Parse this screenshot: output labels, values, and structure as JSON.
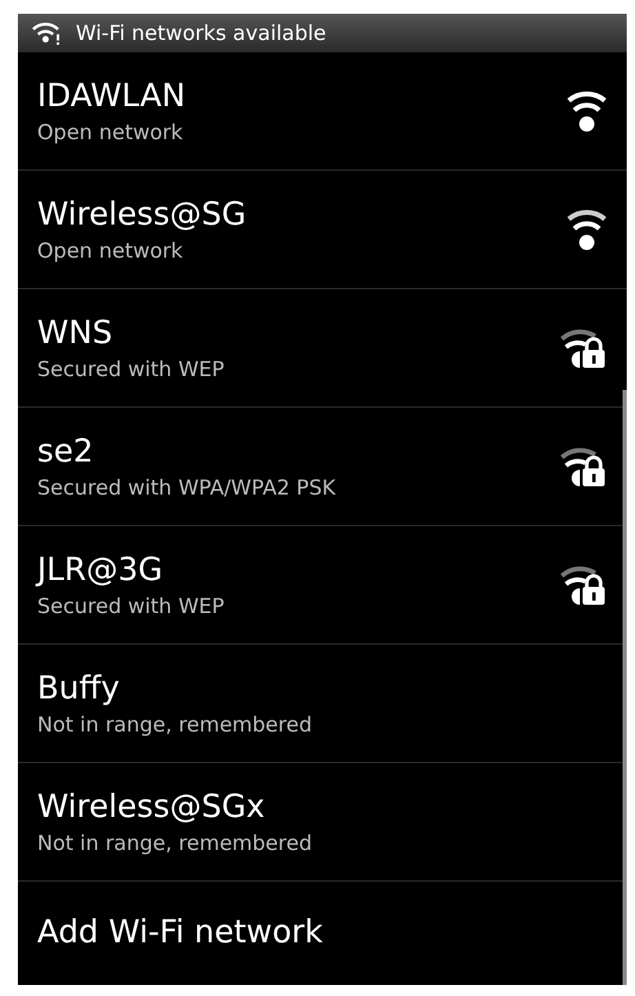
{
  "status_bar": {
    "notification": "Wi-Fi networks available"
  },
  "networks": [
    {
      "name": "IDAWLAN",
      "summary": "Open network",
      "kind": "open"
    },
    {
      "name": "Wireless@SG",
      "summary": "Open network",
      "kind": "open"
    },
    {
      "name": "WNS",
      "summary": "Secured with WEP",
      "kind": "secured"
    },
    {
      "name": "se2",
      "summary": "Secured with WPA/WPA2 PSK",
      "kind": "secured"
    },
    {
      "name": "JLR@3G",
      "summary": "Secured with WEP",
      "kind": "secured"
    },
    {
      "name": "Buffy",
      "summary": "Not in range, remembered",
      "kind": "remembered"
    },
    {
      "name": "Wireless@SGx",
      "summary": "Not in range, remembered",
      "kind": "remembered"
    }
  ],
  "add_network": {
    "label": "Add Wi-Fi network"
  }
}
